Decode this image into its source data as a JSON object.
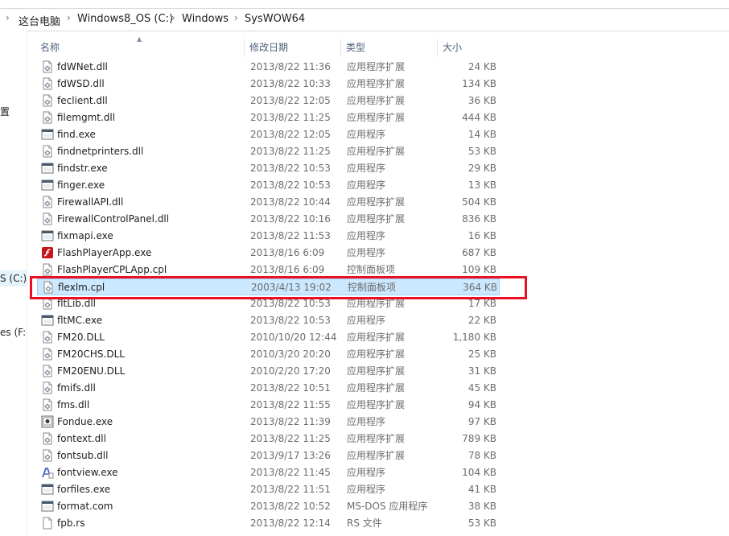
{
  "breadcrumb": {
    "items": [
      "这台电脑",
      "Windows8_OS (C:)",
      "Windows",
      "SysWOW64"
    ],
    "separator": "›"
  },
  "nav": {
    "items": [
      "置",
      "S (C:)",
      "es (F:)"
    ]
  },
  "columns": {
    "name": "名称",
    "date": "修改日期",
    "type": "类型",
    "size": "大小"
  },
  "files": [
    {
      "name": "fdWNet.dll",
      "date": "2013/8/22 11:36",
      "type": "应用程序扩展",
      "size": "24 KB",
      "icon": "dll-icon"
    },
    {
      "name": "fdWSD.dll",
      "date": "2013/8/22 10:33",
      "type": "应用程序扩展",
      "size": "134 KB",
      "icon": "dll-icon"
    },
    {
      "name": "feclient.dll",
      "date": "2013/8/22 12:05",
      "type": "应用程序扩展",
      "size": "36 KB",
      "icon": "dll-icon"
    },
    {
      "name": "filemgmt.dll",
      "date": "2013/8/22 11:25",
      "type": "应用程序扩展",
      "size": "444 KB",
      "icon": "dll-icon"
    },
    {
      "name": "find.exe",
      "date": "2013/8/22 12:05",
      "type": "应用程序",
      "size": "14 KB",
      "icon": "exe-icon"
    },
    {
      "name": "findnetprinters.dll",
      "date": "2013/8/22 11:25",
      "type": "应用程序扩展",
      "size": "53 KB",
      "icon": "dll-icon"
    },
    {
      "name": "findstr.exe",
      "date": "2013/8/22 10:53",
      "type": "应用程序",
      "size": "29 KB",
      "icon": "exe-icon"
    },
    {
      "name": "finger.exe",
      "date": "2013/8/22 10:53",
      "type": "应用程序",
      "size": "13 KB",
      "icon": "exe-icon"
    },
    {
      "name": "FirewallAPI.dll",
      "date": "2013/8/22 10:44",
      "type": "应用程序扩展",
      "size": "504 KB",
      "icon": "dll-icon"
    },
    {
      "name": "FirewallControlPanel.dll",
      "date": "2013/8/22 10:16",
      "type": "应用程序扩展",
      "size": "836 KB",
      "icon": "dll-icon"
    },
    {
      "name": "fixmapi.exe",
      "date": "2013/8/22 11:53",
      "type": "应用程序",
      "size": "16 KB",
      "icon": "exe-icon"
    },
    {
      "name": "FlashPlayerApp.exe",
      "date": "2013/8/16 6:09",
      "type": "应用程序",
      "size": "687 KB",
      "icon": "flash-icon"
    },
    {
      "name": "FlashPlayerCPLApp.cpl",
      "date": "2013/8/16 6:09",
      "type": "控制面板项",
      "size": "109 KB",
      "icon": "dll-icon"
    },
    {
      "name": "flexlm.cpl",
      "date": "2003/4/13 19:02",
      "type": "控制面板项",
      "size": "364 KB",
      "icon": "dll-icon"
    },
    {
      "name": "fltLib.dll",
      "date": "2013/8/22 10:53",
      "type": "应用程序扩展",
      "size": "17 KB",
      "icon": "dll-icon"
    },
    {
      "name": "fltMC.exe",
      "date": "2013/8/22 10:53",
      "type": "应用程序",
      "size": "22 KB",
      "icon": "exe-icon"
    },
    {
      "name": "FM20.DLL",
      "date": "2010/10/20 12:44",
      "type": "应用程序扩展",
      "size": "1,180 KB",
      "icon": "dll-icon"
    },
    {
      "name": "FM20CHS.DLL",
      "date": "2010/3/20 20:20",
      "type": "应用程序扩展",
      "size": "25 KB",
      "icon": "dll-icon"
    },
    {
      "name": "FM20ENU.DLL",
      "date": "2010/2/20 17:20",
      "type": "应用程序扩展",
      "size": "31 KB",
      "icon": "dll-icon"
    },
    {
      "name": "fmifs.dll",
      "date": "2013/8/22 10:51",
      "type": "应用程序扩展",
      "size": "45 KB",
      "icon": "dll-icon"
    },
    {
      "name": "fms.dll",
      "date": "2013/8/22 11:55",
      "type": "应用程序扩展",
      "size": "94 KB",
      "icon": "dll-icon"
    },
    {
      "name": "Fondue.exe",
      "date": "2013/8/22 11:39",
      "type": "应用程序",
      "size": "97 KB",
      "icon": "fondue-icon"
    },
    {
      "name": "fontext.dll",
      "date": "2013/8/22 11:25",
      "type": "应用程序扩展",
      "size": "789 KB",
      "icon": "dll-icon"
    },
    {
      "name": "fontsub.dll",
      "date": "2013/9/17 13:26",
      "type": "应用程序扩展",
      "size": "78 KB",
      "icon": "dll-icon"
    },
    {
      "name": "fontview.exe",
      "date": "2013/8/22 11:45",
      "type": "应用程序",
      "size": "104 KB",
      "icon": "font-icon"
    },
    {
      "name": "forfiles.exe",
      "date": "2013/8/22 11:51",
      "type": "应用程序",
      "size": "41 KB",
      "icon": "exe-icon"
    },
    {
      "name": "format.com",
      "date": "2013/8/22 10:52",
      "type": "MS-DOS 应用程序",
      "size": "38 KB",
      "icon": "exe-icon"
    },
    {
      "name": "fpb.rs",
      "date": "2013/8/22 12:14",
      "type": "RS 文件",
      "size": "53 KB",
      "icon": "file-icon"
    }
  ],
  "selected_index": 13,
  "colors": {
    "selection_bg": "#cce8ff",
    "selection_border": "#99d1ff",
    "highlight_box": "#e81123",
    "header_text": "#4c607a"
  }
}
